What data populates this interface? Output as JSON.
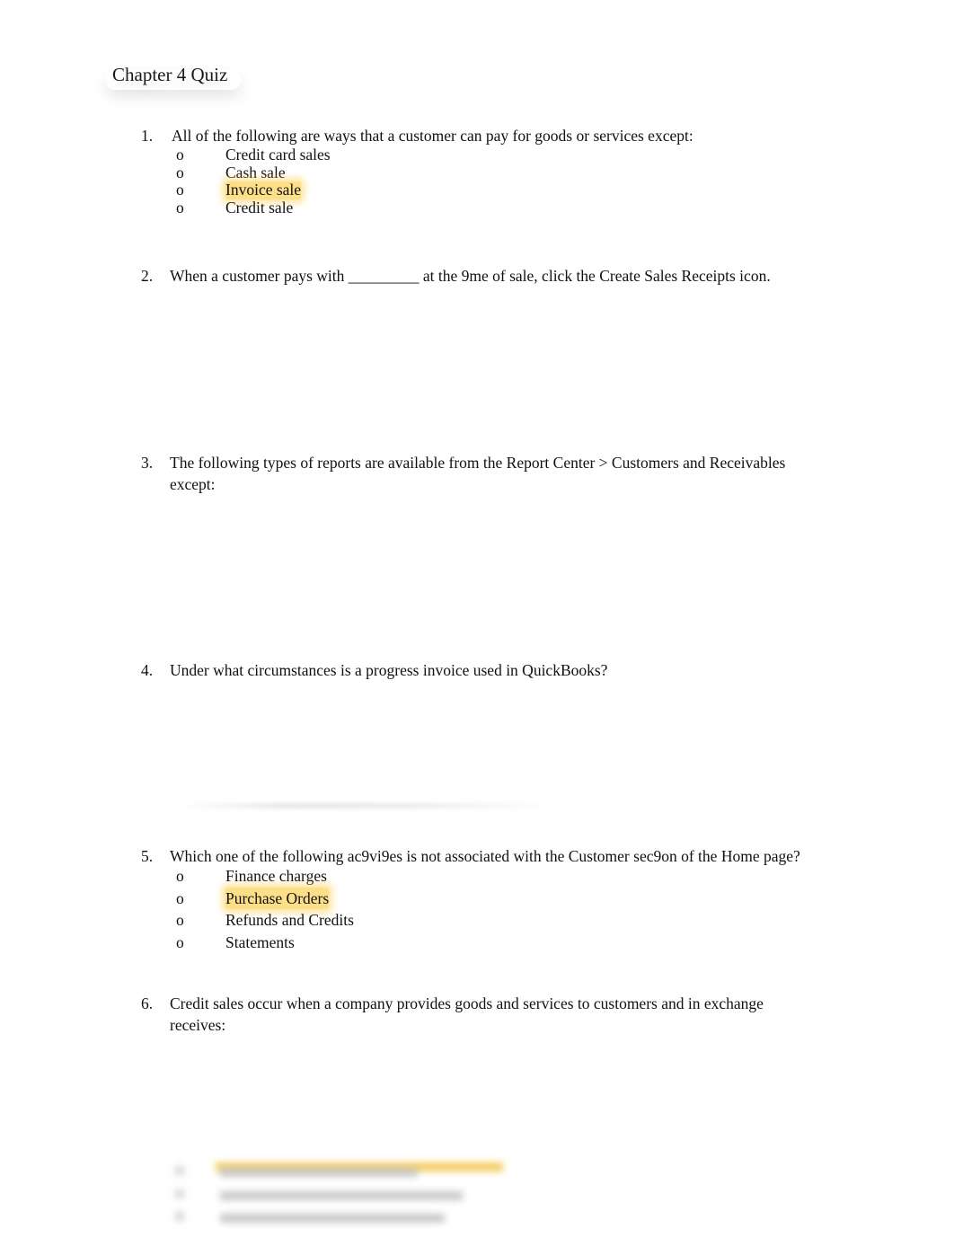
{
  "document": {
    "title": "Chapter 4 Quiz",
    "questions": [
      {
        "number": "1.",
        "text": "All of the following are ways that a customer can pay for goods or services except:",
        "options": [
          {
            "bullet": "o",
            "label": "Credit card sales",
            "highlighted": false
          },
          {
            "bullet": "o",
            "label": "Cash sale",
            "highlighted": false
          },
          {
            "bullet": "o",
            "label": "Invoice sale",
            "highlighted": true
          },
          {
            "bullet": "o",
            "label": "Credit sale",
            "highlighted": false
          }
        ]
      },
      {
        "number": "2.",
        "text": "When a customer pays with _________ at the 9me of sale, click the Create Sales Receipts icon."
      },
      {
        "number": "3.",
        "text": "The following types of reports are available from the Report Center > Customers and Receivables except:"
      },
      {
        "number": "4.",
        "text": "Under what circumstances is a progress invoice used in QuickBooks?"
      },
      {
        "number": "5.",
        "text": "Which one of the following ac9vi9es is not associated with the Customer sec9on of the Home page?",
        "options": [
          {
            "bullet": "o",
            "label": "Finance charges",
            "highlighted": false
          },
          {
            "bullet": "o",
            "label": "Purchase Orders",
            "highlighted": true
          },
          {
            "bullet": "o",
            "label": "Refunds and Credits",
            "highlighted": false
          },
          {
            "bullet": "o",
            "label": "Statements",
            "highlighted": false
          }
        ]
      },
      {
        "number": "6.",
        "text": "Credit sales occur when a company provides goods and services to customers and in exchange receives:"
      }
    ],
    "highlight_color": "#FCC428"
  }
}
